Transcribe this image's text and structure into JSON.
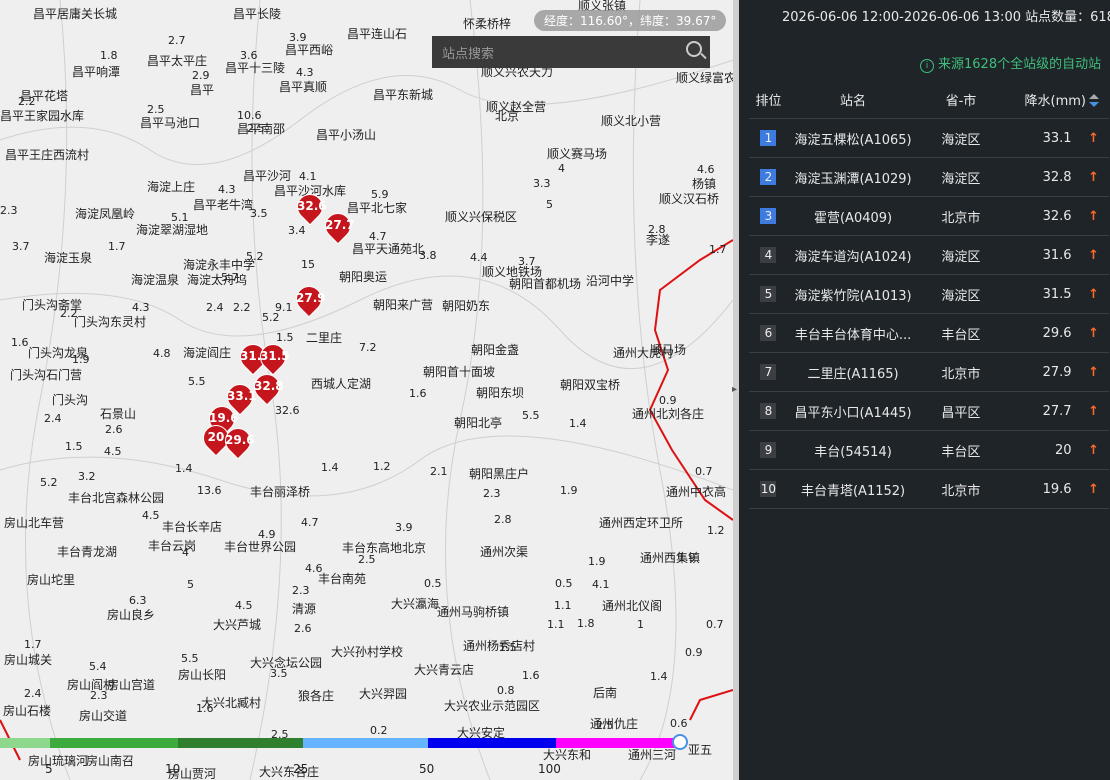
{
  "map": {
    "coord_readout": "经度：116.60°，纬度：39.67°",
    "search_placeholder": "站点搜索",
    "places": [
      [
        "昌平居庸关长城",
        33,
        8
      ],
      [
        "昌平长陵",
        233,
        8
      ],
      [
        "昌平十三陵",
        225,
        62
      ],
      [
        "昌平花塔",
        20,
        90
      ],
      [
        "昌平响潭",
        72,
        66
      ],
      [
        "昌平太平庄",
        147,
        55
      ],
      [
        "昌平",
        190,
        84
      ],
      [
        "昌平西峪",
        285,
        44
      ],
      [
        "昌平连山石",
        347,
        28
      ],
      [
        "怀柔桥梓",
        463,
        18
      ],
      [
        "顺义张镇",
        578,
        0
      ],
      [
        "顺义兴农天力",
        481,
        66
      ],
      [
        "顺义绿富农",
        676,
        72
      ],
      [
        "昌平真顺",
        279,
        81
      ],
      [
        "昌平东新城",
        373,
        89
      ],
      [
        "昌平王家园水库",
        0,
        110
      ],
      [
        "顺义赵全营",
        486,
        101
      ],
      [
        "顺义北小营",
        601,
        115
      ],
      [
        "昌平马池口",
        140,
        117
      ],
      [
        "昌平南邵",
        237,
        123
      ],
      [
        "昌平小汤山",
        316,
        129
      ],
      [
        "北京",
        495,
        110
      ],
      [
        "昌平王庄西流村",
        5,
        149
      ],
      [
        "顺义赛马场",
        547,
        148
      ],
      [
        "海淀上庄",
        147,
        181
      ],
      [
        "昌平沙河",
        243,
        170
      ],
      [
        "昌平沙河水库",
        274,
        185
      ],
      [
        "顺义汉石桥",
        659,
        193
      ],
      [
        "杨镇",
        692,
        178
      ],
      [
        "海淀凤凰岭",
        75,
        208
      ],
      [
        "昌平老牛湾",
        193,
        199
      ],
      [
        "昌平北七家",
        347,
        202
      ],
      [
        "顺义兴保税区",
        445,
        211
      ],
      [
        "海淀翠湖湿地",
        136,
        224
      ],
      [
        "昌平天通苑北",
        352,
        243
      ],
      [
        "李遂",
        646,
        234
      ],
      [
        "海淀玉泉",
        44,
        252
      ],
      [
        "海淀永丰中学",
        183,
        259
      ],
      [
        "海淀温泉",
        131,
        274
      ],
      [
        "海淀太舟坞",
        187,
        274
      ],
      [
        "朝阳奥运",
        339,
        271
      ],
      [
        "顺义地铁场",
        482,
        266
      ],
      [
        "朝阳首都机场",
        509,
        278
      ],
      [
        "沿河中学",
        586,
        275
      ],
      [
        "门头沟斋堂",
        22,
        299
      ],
      [
        "朝阳来广营",
        373,
        299
      ],
      [
        "朝阳奶东",
        442,
        300
      ],
      [
        "门头沟东灵村",
        74,
        316
      ],
      [
        "二里庄",
        306,
        332
      ],
      [
        "朝阳金盏",
        471,
        344
      ],
      [
        "通州大虎村",
        613,
        347
      ],
      [
        "顺马场",
        650,
        344
      ],
      [
        "门头沟龙泉",
        28,
        347
      ],
      [
        "海淀阎庄",
        183,
        347
      ],
      [
        "西城人定湖",
        311,
        378
      ],
      [
        "朝阳首十面坡",
        423,
        366
      ],
      [
        "门头沟石门营",
        10,
        369
      ],
      [
        "朝阳东坝",
        476,
        387
      ],
      [
        "朝阳双宝桥",
        560,
        379
      ],
      [
        "门头沟",
        52,
        394
      ],
      [
        "石景山",
        100,
        408
      ],
      [
        "朝阳北亭",
        454,
        417
      ],
      [
        "通州北刘各庄",
        632,
        408
      ],
      [
        "丰台北宫森林公园",
        68,
        492
      ],
      [
        "丰台丽泽桥",
        250,
        486
      ],
      [
        "朝阳黑庄户",
        469,
        468
      ],
      [
        "通州中衣高",
        666,
        486
      ],
      [
        "房山北车营",
        4,
        517
      ],
      [
        "丰台长辛店",
        162,
        521
      ],
      [
        "通州西定环卫所",
        599,
        517
      ],
      [
        "丰台青龙湖",
        57,
        546
      ],
      [
        "丰台世界公园",
        224,
        541
      ],
      [
        "丰台东高地北京",
        342,
        542
      ],
      [
        "通州次渠",
        480,
        546
      ],
      [
        "通州西集镇",
        640,
        552
      ],
      [
        "房山坨里",
        27,
        574
      ],
      [
        "丰台云岗",
        148,
        540
      ],
      [
        "丰台南苑",
        318,
        573
      ],
      [
        "大兴瀛海",
        391,
        598
      ],
      [
        "通州马驹桥镇",
        437,
        606
      ],
      [
        "房山良乡",
        107,
        609
      ],
      [
        "大兴芦城",
        213,
        619
      ],
      [
        "清源",
        292,
        603
      ],
      [
        "通州北仪阁",
        602,
        600
      ],
      [
        "房山城关",
        4,
        654
      ],
      [
        "大兴孙村学校",
        331,
        646
      ],
      [
        "通州杨秀店村",
        463,
        640
      ],
      [
        "房山长阳",
        178,
        669
      ],
      [
        "大兴念坛公园",
        250,
        657
      ],
      [
        "大兴青云店",
        414,
        664
      ],
      [
        "房山阎村",
        67,
        679
      ],
      [
        "房山宫道",
        107,
        679
      ],
      [
        "大兴北臧村",
        201,
        697
      ],
      [
        "狼各庄",
        298,
        690
      ],
      [
        "大兴羿园",
        359,
        688
      ],
      [
        "大兴农业示范园区",
        444,
        700
      ],
      [
        "房山石楼",
        3,
        705
      ],
      [
        "房山交道",
        79,
        710
      ],
      [
        "后南",
        593,
        687
      ],
      [
        "通州仇庄",
        590,
        718
      ],
      [
        "大兴安定",
        457,
        727
      ],
      [
        "大兴东和",
        543,
        749
      ],
      [
        "通州三河",
        628,
        749
      ],
      [
        "房山琉璃河",
        28,
        755
      ],
      [
        "房山南召",
        86,
        755
      ],
      [
        "房山贾河",
        168,
        768
      ],
      [
        "大兴东各庄",
        259,
        766
      ],
      [
        "亚五",
        688,
        744
      ]
    ],
    "numbers": [
      [
        1.8,
        100,
        50
      ],
      [
        2.7,
        168,
        35
      ],
      [
        2.9,
        192,
        70
      ],
      [
        3.6,
        240,
        50
      ],
      [
        3.9,
        289,
        32
      ],
      [
        4.3,
        296,
        67
      ],
      [
        2.2,
        18,
        96
      ],
      [
        2.5,
        147,
        104
      ],
      [
        10.6,
        237,
        110
      ],
      [
        2.5,
        247,
        123
      ],
      [
        4.1,
        299,
        171
      ],
      [
        4.3,
        218,
        184
      ],
      [
        5.9,
        371,
        189
      ],
      [
        3.5,
        250,
        208
      ],
      [
        3.4,
        288,
        225
      ],
      [
        2.3,
        0,
        205
      ],
      [
        1.7,
        108,
        241
      ],
      [
        5.1,
        171,
        212
      ],
      [
        3.7,
        12,
        241
      ],
      [
        5.2,
        246,
        251
      ],
      [
        5.7,
        221,
        272
      ],
      [
        15.0,
        301,
        259
      ],
      [
        4.7,
        369,
        231
      ],
      [
        3.8,
        419,
        250
      ],
      [
        4.4,
        470,
        252
      ],
      [
        3.7,
        518,
        256
      ],
      [
        2.8,
        648,
        224
      ],
      [
        1.7,
        709,
        244
      ],
      [
        3.3,
        533,
        178
      ],
      [
        4.0,
        558,
        163
      ],
      [
        4.6,
        697,
        164
      ],
      [
        5.0,
        546,
        199
      ],
      [
        4.3,
        132,
        302
      ],
      [
        2.4,
        206,
        302
      ],
      [
        2.2,
        233,
        302
      ],
      [
        5.2,
        262,
        312
      ],
      [
        9.1,
        275,
        302
      ],
      [
        2.2,
        60,
        308
      ],
      [
        1.6,
        11,
        337
      ],
      [
        1.5,
        276,
        332
      ],
      [
        1.9,
        72,
        354
      ],
      [
        4.8,
        153,
        348
      ],
      [
        5.5,
        188,
        376
      ],
      [
        7.2,
        359,
        342
      ],
      [
        0.9,
        659,
        395
      ],
      [
        2.4,
        44,
        413
      ],
      [
        2.6,
        105,
        424
      ],
      [
        32.6,
        275,
        405
      ],
      [
        1.6,
        409,
        388
      ],
      [
        5.5,
        522,
        410
      ],
      [
        1.4,
        569,
        418
      ],
      [
        1.5,
        65,
        441
      ],
      [
        4.5,
        104,
        446
      ],
      [
        1.4,
        321,
        462
      ],
      [
        1.2,
        373,
        461
      ],
      [
        2.1,
        430,
        466
      ],
      [
        0.7,
        695,
        466
      ],
      [
        5.2,
        40,
        477
      ],
      [
        3.2,
        78,
        471
      ],
      [
        1.4,
        175,
        463
      ],
      [
        13.6,
        197,
        485
      ],
      [
        2.3,
        483,
        488
      ],
      [
        1.9,
        560,
        485
      ],
      [
        4.5,
        142,
        510
      ],
      [
        4.9,
        258,
        529
      ],
      [
        3.9,
        395,
        522
      ],
      [
        4.7,
        301,
        517
      ],
      [
        2.8,
        494,
        514
      ],
      [
        1.2,
        707,
        525
      ],
      [
        4.0,
        182,
        547
      ],
      [
        4.6,
        305,
        563
      ],
      [
        2.5,
        358,
        554
      ],
      [
        1.9,
        588,
        556
      ],
      [
        1.9,
        678,
        552
      ],
      [
        2.3,
        292,
        585
      ],
      [
        0.5,
        424,
        578
      ],
      [
        0.5,
        555,
        578
      ],
      [
        1.1,
        554,
        600
      ],
      [
        4.1,
        592,
        579
      ],
      [
        6.3,
        129,
        595
      ],
      [
        5.0,
        187,
        579
      ],
      [
        4.5,
        235,
        600
      ],
      [
        2.6,
        294,
        623
      ],
      [
        1.1,
        547,
        619
      ],
      [
        1.8,
        577,
        618
      ],
      [
        1.0,
        637,
        619
      ],
      [
        0.7,
        706,
        619
      ],
      [
        0.9,
        685,
        647
      ],
      [
        1.7,
        24,
        639
      ],
      [
        5.4,
        89,
        661
      ],
      [
        5.5,
        181,
        653
      ],
      [
        3.5,
        270,
        668
      ],
      [
        1.5,
        499,
        642
      ],
      [
        1.6,
        522,
        670
      ],
      [
        1.4,
        650,
        671
      ],
      [
        2.4,
        24,
        688
      ],
      [
        2.3,
        90,
        690
      ],
      [
        1.6,
        196,
        703
      ],
      [
        0.8,
        497,
        685
      ],
      [
        2.5,
        271,
        729
      ],
      [
        0.2,
        370,
        725
      ],
      [
        0.6,
        670,
        718
      ],
      [
        2.5,
        596,
        720
      ]
    ],
    "pins": [
      [
        32.6,
        297,
        194
      ],
      [
        27.7,
        325,
        213
      ],
      [
        27.9,
        296,
        286
      ],
      [
        31.1,
        240,
        344
      ],
      [
        31.5,
        260,
        344
      ],
      [
        32.8,
        254,
        374
      ],
      [
        33.1,
        227,
        384
      ],
      [
        19.6,
        209,
        406
      ],
      [
        20,
        203,
        425
      ],
      [
        29.6,
        225,
        428
      ]
    ],
    "legend_ticks": [
      "5",
      "10",
      "25",
      "50",
      "100"
    ]
  },
  "panel": {
    "header": "2026-06-06 12:00-2026-06-06 13:00  站点数量：618/1628",
    "source": "来源1628个全站级的自动站",
    "columns": {
      "rank": "排位",
      "station": "站名",
      "district": "省-市",
      "rain": "降水(mm)"
    },
    "rows": [
      {
        "rank": "1",
        "station": "海淀五棵松(A1065)",
        "district": "海淀区",
        "rain": "33.1"
      },
      {
        "rank": "2",
        "station": "海淀玉渊潭(A1029)",
        "district": "海淀区",
        "rain": "32.8"
      },
      {
        "rank": "3",
        "station": "霍营(A0409)",
        "district": "北京市",
        "rain": "32.6"
      },
      {
        "rank": "4",
        "station": "海淀车道沟(A1024)",
        "district": "海淀区",
        "rain": "31.6"
      },
      {
        "rank": "5",
        "station": "海淀紫竹院(A1013)",
        "district": "海淀区",
        "rain": "31.5"
      },
      {
        "rank": "6",
        "station": "丰台丰台体育中心...",
        "district": "丰台区",
        "rain": "29.6"
      },
      {
        "rank": "7",
        "station": "二里庄(A1165)",
        "district": "北京市",
        "rain": "27.9"
      },
      {
        "rank": "8",
        "station": "昌平东小口(A1445)",
        "district": "昌平区",
        "rain": "27.7"
      },
      {
        "rank": "9",
        "station": "丰台(54514)",
        "district": "丰台区",
        "rain": "20"
      },
      {
        "rank": "10",
        "station": "丰台青塔(A1152)",
        "district": "北京市",
        "rain": "19.6"
      }
    ]
  },
  "colors": {
    "accent": "#3d7be0",
    "pin": "#c4161c",
    "up_arrow": "#ff6a28",
    "source_text": "#3fbf7a"
  }
}
